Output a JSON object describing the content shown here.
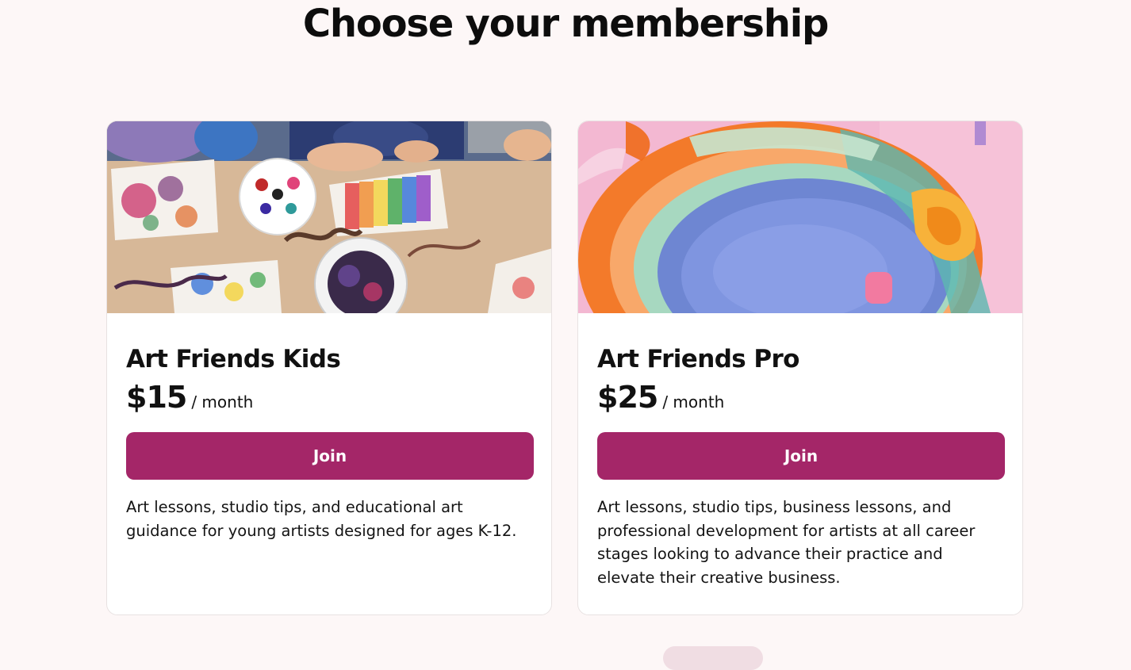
{
  "page": {
    "title": "Choose your membership"
  },
  "plans": [
    {
      "name": "Art Friends Kids",
      "price": "$15",
      "period": "/ month",
      "cta": "Join",
      "description": "Art lessons, studio tips, and educational art guidance for young artists designed for ages K-12."
    },
    {
      "name": "Art Friends Pro",
      "price": "$25",
      "period": "/ month",
      "cta": "Join",
      "description": "Art lessons, studio tips, business lessons, and professional development for artists at all career stages looking to advance their practice and elevate their creative business."
    }
  ],
  "colors": {
    "background": "#fdf7f7",
    "accent": "#a42668",
    "card": "#ffffff"
  }
}
